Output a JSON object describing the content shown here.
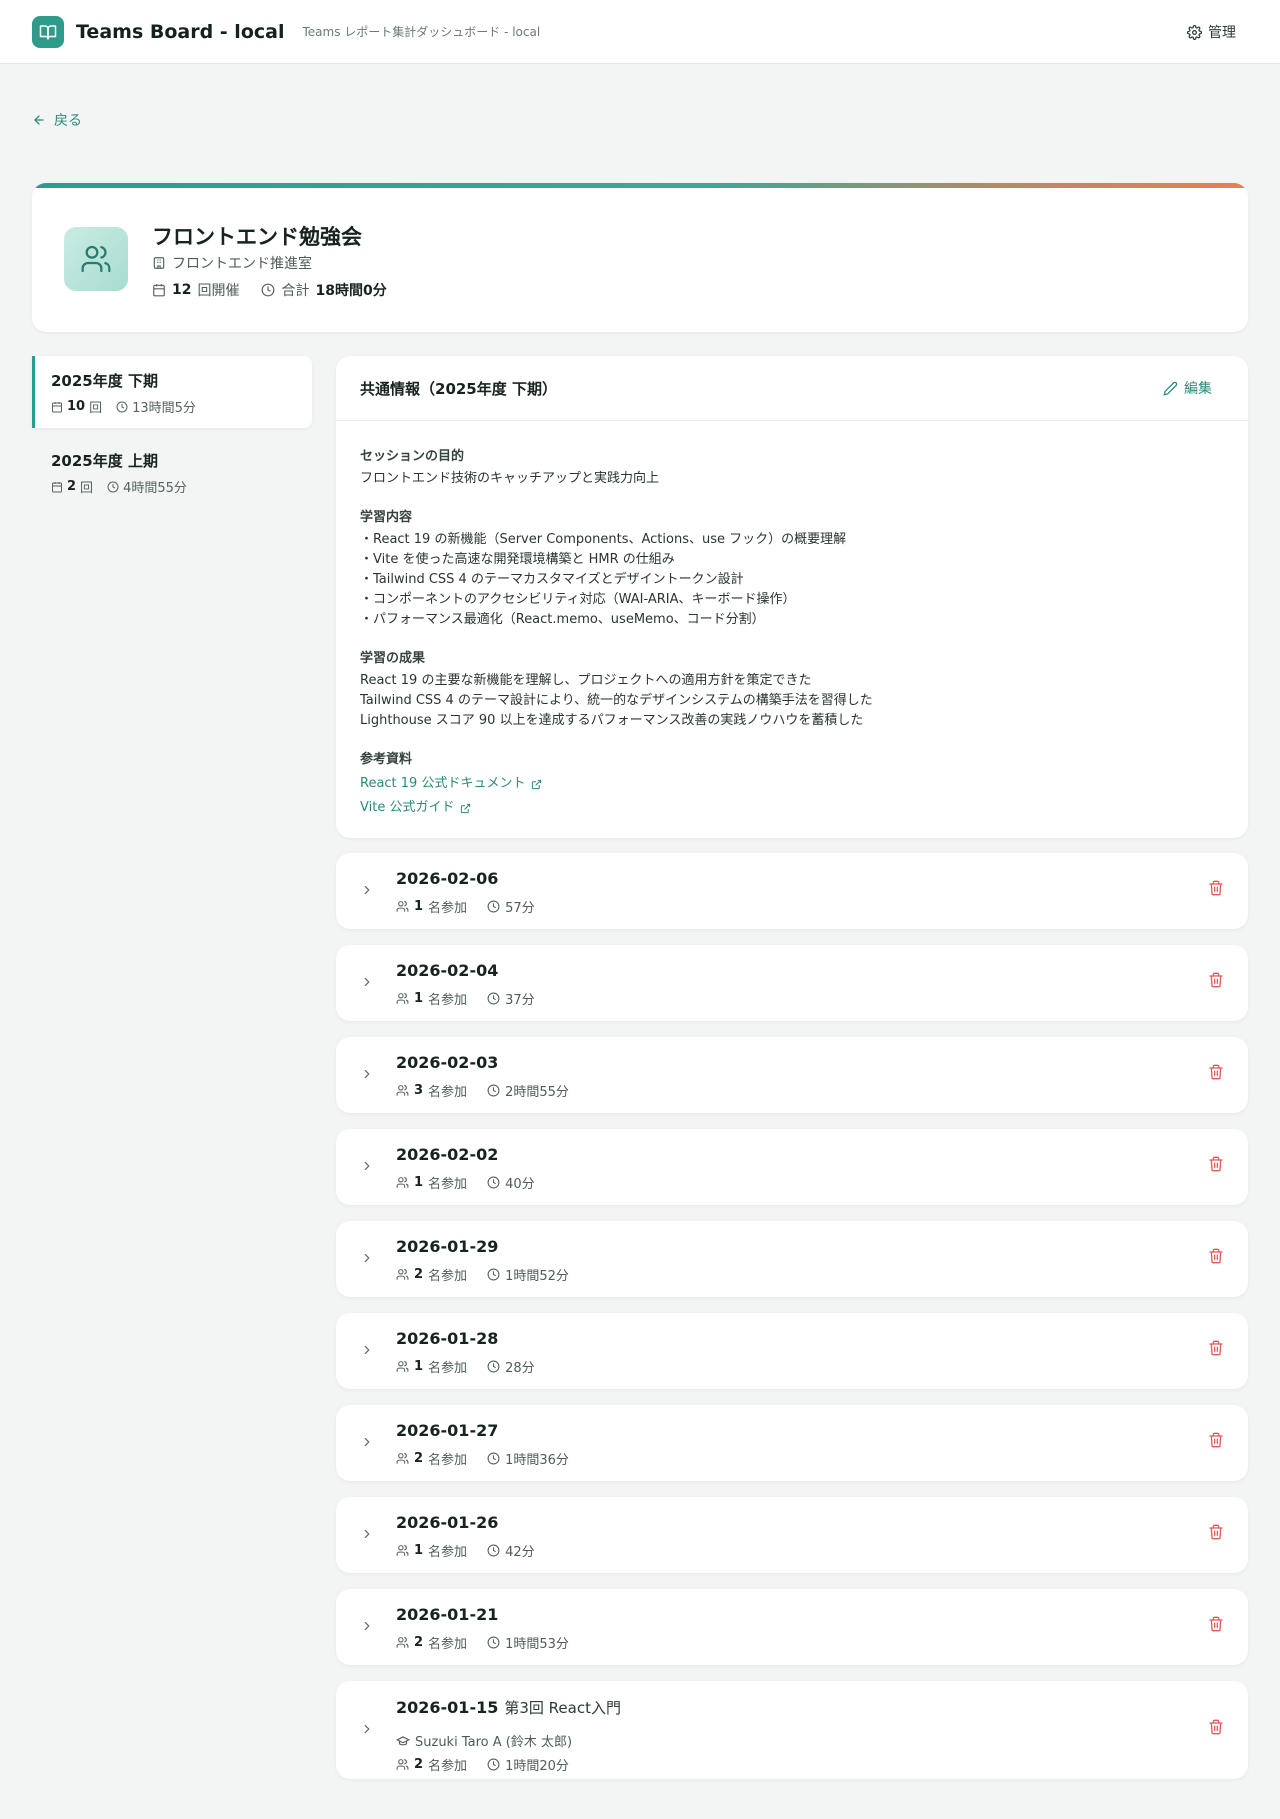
{
  "header": {
    "app_title": "Teams Board - local",
    "app_subtitle": "Teams レポート集計ダッシュボード - local",
    "admin_label": "管理"
  },
  "nav": {
    "back_label": "戻る"
  },
  "hero": {
    "title": "フロントエンド勉強会",
    "department": "フロントエンド推進室",
    "count_value": "12",
    "count_suffix": "回開催",
    "total_label": "合計",
    "total_value": "18時間0分"
  },
  "terms": [
    {
      "title": "2025年度 下期",
      "count": "10",
      "count_unit": "回",
      "duration": "13時間5分",
      "active": true
    },
    {
      "title": "2025年度 上期",
      "count": "2",
      "count_unit": "回",
      "duration": "4時間55分",
      "active": false
    }
  ],
  "info": {
    "title": "共通情報（2025年度 下期）",
    "edit_label": "編集",
    "purpose_label": "セッションの目的",
    "purpose": "フロントエンド技術のキャッチアップと実践力向上",
    "content_label": "学習内容",
    "content": [
      "・React 19 の新機能（Server Components、Actions、use フック）の概要理解",
      "・Vite を使った高速な開発環境構築と HMR の仕組み",
      "・Tailwind CSS 4 のテーマカスタマイズとデザイントークン設計",
      "・コンポーネントのアクセシビリティ対応（WAI-ARIA、キーボード操作）",
      "・パフォーマンス最適化（React.memo、useMemo、コード分割）"
    ],
    "outcome_label": "学習の成果",
    "outcome": [
      "React 19 の主要な新機能を理解し、プロジェクトへの適用方針を策定できた",
      "Tailwind CSS 4 のテーマ設計により、統一的なデザインシステムの構築手法を習得した",
      "Lighthouse スコア 90 以上を達成するパフォーマンス改善の実践ノウハウを蓄積した"
    ],
    "refs_label": "参考資料",
    "refs": [
      "React 19 公式ドキュメント",
      "Vite 公式ガイド"
    ]
  },
  "sessions": [
    {
      "date": "2026-02-06",
      "participants": "1",
      "participants_suffix": "名参加",
      "duration": "57分"
    },
    {
      "date": "2026-02-04",
      "participants": "1",
      "participants_suffix": "名参加",
      "duration": "37分"
    },
    {
      "date": "2026-02-03",
      "participants": "3",
      "participants_suffix": "名参加",
      "duration": "2時間55分"
    },
    {
      "date": "2026-02-02",
      "participants": "1",
      "participants_suffix": "名参加",
      "duration": "40分"
    },
    {
      "date": "2026-01-29",
      "participants": "2",
      "participants_suffix": "名参加",
      "duration": "1時間52分"
    },
    {
      "date": "2026-01-28",
      "participants": "1",
      "participants_suffix": "名参加",
      "duration": "28分"
    },
    {
      "date": "2026-01-27",
      "participants": "2",
      "participants_suffix": "名参加",
      "duration": "1時間36分"
    },
    {
      "date": "2026-01-26",
      "participants": "1",
      "participants_suffix": "名参加",
      "duration": "42分"
    },
    {
      "date": "2026-01-21",
      "participants": "2",
      "participants_suffix": "名参加",
      "duration": "1時間53分"
    },
    {
      "date": "2026-01-15",
      "topic": "第3回 React入門",
      "presenter": "Suzuki Taro A (鈴木 太郎)",
      "participants": "2",
      "participants_suffix": "名参加",
      "duration": "1時間20分"
    }
  ],
  "colors": {
    "accent": "#2a9d8f",
    "delete": "#e05a5a",
    "gradient_end": "#ec7d5a"
  }
}
